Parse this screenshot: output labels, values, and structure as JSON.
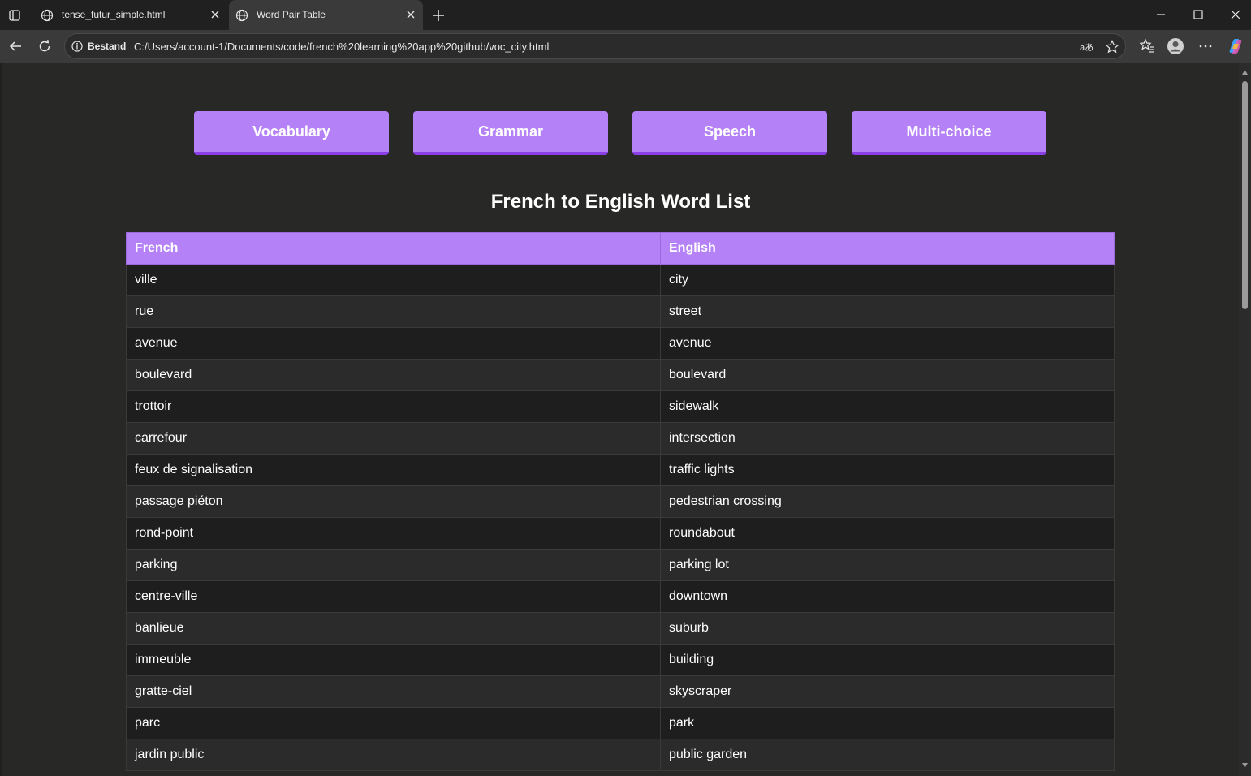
{
  "browser": {
    "tabs": [
      {
        "title": "tense_futur_simple.html",
        "active": false
      },
      {
        "title": "Word Pair Table",
        "active": true
      }
    ],
    "address": {
      "site_info_label": "Bestand",
      "url": "C:/Users/account-1/Documents/code/french%20learning%20app%20github/voc_city.html"
    }
  },
  "page": {
    "nav_buttons": [
      "Vocabulary",
      "Grammar",
      "Speech",
      "Multi-choice"
    ],
    "title": "French to English Word List",
    "table": {
      "headers": [
        "French",
        "English"
      ],
      "rows": [
        [
          "ville",
          "city"
        ],
        [
          "rue",
          "street"
        ],
        [
          "avenue",
          "avenue"
        ],
        [
          "boulevard",
          "boulevard"
        ],
        [
          "trottoir",
          "sidewalk"
        ],
        [
          "carrefour",
          "intersection"
        ],
        [
          "feux de signalisation",
          "traffic lights"
        ],
        [
          "passage piéton",
          "pedestrian crossing"
        ],
        [
          "rond-point",
          "roundabout"
        ],
        [
          "parking",
          "parking lot"
        ],
        [
          "centre-ville",
          "downtown"
        ],
        [
          "banlieue",
          "suburb"
        ],
        [
          "immeuble",
          "building"
        ],
        [
          "gratte-ciel",
          "skyscraper"
        ],
        [
          "parc",
          "park"
        ],
        [
          "jardin public",
          "public garden"
        ]
      ]
    }
  },
  "colors": {
    "accent": "#b481f7",
    "accent_dark": "#8c3fe6",
    "page_bg": "#282826"
  }
}
